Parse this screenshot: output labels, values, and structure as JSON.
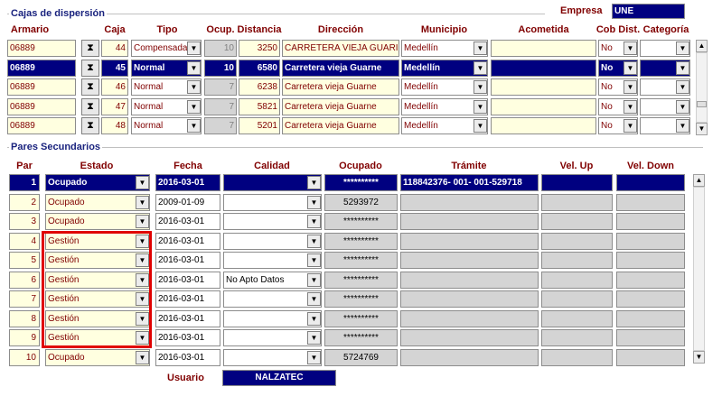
{
  "cajas": {
    "section_title": "Cajas de dispersión",
    "empresa_label": "Empresa",
    "empresa_value": "UNE",
    "headers": {
      "armario": "Armario",
      "caja": "Caja",
      "tipo": "Tipo",
      "ocup": "Ocup.",
      "distancia": "Distancia",
      "direccion": "Dirección",
      "municipio": "Municipio",
      "acometida": "Acometida",
      "cob": "Cob Dist.",
      "categoria": "Categoría"
    },
    "rows": [
      {
        "armario": "06889",
        "caja": "44",
        "tipo": "Compensada",
        "ocup": "10",
        "distancia": "3250",
        "direccion": "CARRETERA VIEJA GUARI",
        "municipio": "Medellín",
        "acometida": "",
        "cob": "No",
        "categoria": ""
      },
      {
        "armario": "06889",
        "caja": "45",
        "tipo": "Normal",
        "ocup": "10",
        "distancia": "6580",
        "direccion": "Carretera vieja Guarne",
        "municipio": "Medellín",
        "acometida": "",
        "cob": "No",
        "categoria": ""
      },
      {
        "armario": "06889",
        "caja": "46",
        "tipo": "Normal",
        "ocup": "7",
        "distancia": "6238",
        "direccion": "Carretera vieja Guarne",
        "municipio": "Medellín",
        "acometida": "",
        "cob": "No",
        "categoria": ""
      },
      {
        "armario": "06889",
        "caja": "47",
        "tipo": "Normal",
        "ocup": "7",
        "distancia": "5821",
        "direccion": "Carretera vieja Guarne",
        "municipio": "Medellín",
        "acometida": "",
        "cob": "No",
        "categoria": ""
      },
      {
        "armario": "06889",
        "caja": "48",
        "tipo": "Normal",
        "ocup": "7",
        "distancia": "5201",
        "direccion": "Carretera vieja Guarne",
        "municipio": "Medellín",
        "acometida": "",
        "cob": "No",
        "categoria": ""
      }
    ],
    "selected_row": 1
  },
  "pares": {
    "section_title": "Pares Secundarios",
    "headers": {
      "par": "Par",
      "estado": "Estado",
      "fecha": "Fecha",
      "calidad": "Calidad",
      "ocupado": "Ocupado",
      "tramite": "Trámite",
      "vel_up": "Vel. Up",
      "vel_down": "Vel. Down"
    },
    "rows": [
      {
        "par": "1",
        "estado": "Ocupado",
        "fecha": "2016-03-01",
        "calidad": "",
        "ocupado": "**********",
        "tramite": "118842376- 001- 001-529718",
        "vel_up": "",
        "vel_down": ""
      },
      {
        "par": "2",
        "estado": "Ocupado",
        "fecha": "2009-01-09",
        "calidad": "",
        "ocupado": "5293972",
        "tramite": "",
        "vel_up": "",
        "vel_down": ""
      },
      {
        "par": "3",
        "estado": "Ocupado",
        "fecha": "2016-03-01",
        "calidad": "",
        "ocupado": "**********",
        "tramite": "",
        "vel_up": "",
        "vel_down": ""
      },
      {
        "par": "4",
        "estado": "Gestión",
        "fecha": "2016-03-01",
        "calidad": "",
        "ocupado": "**********",
        "tramite": "",
        "vel_up": "",
        "vel_down": ""
      },
      {
        "par": "5",
        "estado": "Gestión",
        "fecha": "2016-03-01",
        "calidad": "",
        "ocupado": "**********",
        "tramite": "",
        "vel_up": "",
        "vel_down": ""
      },
      {
        "par": "6",
        "estado": "Gestión",
        "fecha": "2016-03-01",
        "calidad": "No Apto Datos",
        "ocupado": "**********",
        "tramite": "",
        "vel_up": "",
        "vel_down": ""
      },
      {
        "par": "7",
        "estado": "Gestión",
        "fecha": "2016-03-01",
        "calidad": "",
        "ocupado": "**********",
        "tramite": "",
        "vel_up": "",
        "vel_down": ""
      },
      {
        "par": "8",
        "estado": "Gestión",
        "fecha": "2016-03-01",
        "calidad": "",
        "ocupado": "**********",
        "tramite": "",
        "vel_up": "",
        "vel_down": ""
      },
      {
        "par": "9",
        "estado": "Gestión",
        "fecha": "2016-03-01",
        "calidad": "",
        "ocupado": "**********",
        "tramite": "",
        "vel_up": "",
        "vel_down": ""
      },
      {
        "par": "10",
        "estado": "Ocupado",
        "fecha": "2016-03-01",
        "calidad": "",
        "ocupado": "5724769",
        "tramite": "",
        "vel_up": "",
        "vel_down": ""
      }
    ],
    "selected_row": 0
  },
  "usuario_label": "Usuario",
  "usuario_value": "NALZATEC",
  "icons": {
    "dropdown": "chevron-down-icon",
    "lookup": "lookup-icon",
    "scroll_up": "scroll-up-icon",
    "scroll_down": "scroll-down-icon"
  },
  "colors": {
    "selected": "#000080",
    "field": "#ffffe0",
    "header_text": "#800000",
    "highlight": "#e00000"
  }
}
